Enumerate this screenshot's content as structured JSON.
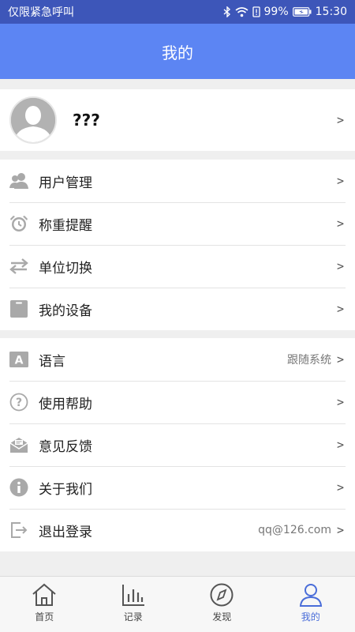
{
  "status_bar": {
    "carrier": "仅限紧急呼叫",
    "battery": "99%",
    "time": "15:30"
  },
  "header": {
    "title": "我的"
  },
  "profile": {
    "name": "???",
    "chevron": ">"
  },
  "menu_group_1": [
    {
      "label": "用户管理",
      "icon": "users-icon",
      "chevron": ">"
    },
    {
      "label": "称重提醒",
      "icon": "alarm-clock-icon",
      "chevron": ">"
    },
    {
      "label": "单位切换",
      "icon": "swap-arrows-icon",
      "chevron": ">"
    },
    {
      "label": "我的设备",
      "icon": "device-icon",
      "chevron": ">"
    }
  ],
  "menu_group_2": [
    {
      "label": "语言",
      "icon": "language-icon",
      "value": "跟随系统",
      "chevron": ">"
    },
    {
      "label": "使用帮助",
      "icon": "help-icon",
      "chevron": ">"
    },
    {
      "label": "意见反馈",
      "icon": "feedback-mail-icon",
      "chevron": ">"
    },
    {
      "label": "关于我们",
      "icon": "info-icon",
      "chevron": ">"
    },
    {
      "label": "退出登录",
      "icon": "logout-icon",
      "value": "qq@126.com",
      "chevron": ">"
    }
  ],
  "tab_bar": [
    {
      "label": "首页",
      "icon": "home-icon"
    },
    {
      "label": "记录",
      "icon": "chart-icon"
    },
    {
      "label": "发现",
      "icon": "compass-icon"
    },
    {
      "label": "我的",
      "icon": "person-icon"
    }
  ],
  "colors": {
    "status_bar": "#3d56b9",
    "app_bar": "#5c85f3",
    "accent": "#4a6dd9",
    "icon_gray": "#a9a9a9"
  }
}
